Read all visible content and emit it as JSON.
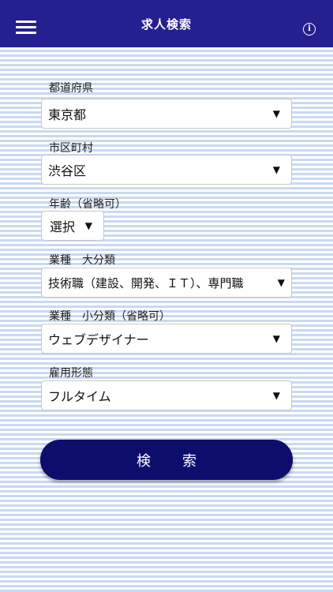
{
  "header": {
    "title": "求人検索",
    "menu_icon": "hamburger-menu-icon",
    "info_icon": "info-icon",
    "info_glyph": "i",
    "background_color": "#25208f"
  },
  "form": {
    "prefecture": {
      "label": "都道府県",
      "value": "東京都"
    },
    "city": {
      "label": "市区町村",
      "value": "渋谷区"
    },
    "age": {
      "label": "年齢（省略可）",
      "value": "選択"
    },
    "category_major": {
      "label": "業種　大分類",
      "value": "技術職（建設、開発、ＩＴ）、専門職"
    },
    "category_minor": {
      "label": "業種　小分類（省略可）",
      "value": "ウェブデザイナー"
    },
    "employment": {
      "label": "雇用形態",
      "value": "フルタイム"
    },
    "dropdown_arrow": "▼"
  },
  "search_button": {
    "label": "検索",
    "color": "#0d0e6c"
  }
}
